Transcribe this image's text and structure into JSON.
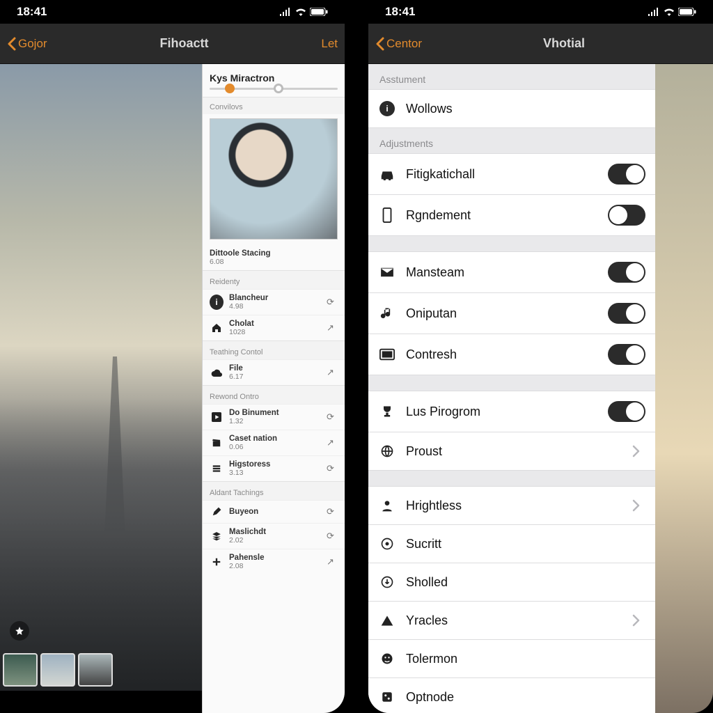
{
  "status": {
    "time": "18:41"
  },
  "left": {
    "nav": {
      "back": "Gojor",
      "title": "Fihoactt",
      "action": "Let"
    },
    "panel": {
      "header": "Kys Miractron",
      "groups": [
        {
          "caption": "Convilovs",
          "portrait": true,
          "meta": {
            "label": "Dittoole Stacing",
            "sub": "6.08"
          }
        },
        {
          "caption": "Reidenty",
          "items": [
            {
              "icon": "badge-icon",
              "label": "Blancheur",
              "sub": "4.98",
              "acc": "loop"
            },
            {
              "icon": "home-icon",
              "label": "Cholat",
              "sub": "1028",
              "acc": "out"
            }
          ]
        },
        {
          "caption": "Teathing Contol",
          "items": [
            {
              "icon": "cloud-icon",
              "label": "File",
              "sub": "6.17",
              "acc": "out"
            }
          ]
        },
        {
          "caption": "Rewond Ontro",
          "items": [
            {
              "icon": "play-icon",
              "label": "Do Binument",
              "sub": "1.32",
              "acc": "loop"
            },
            {
              "icon": "clapper-icon",
              "label": "Caset nation",
              "sub": "0.06",
              "acc": "out"
            },
            {
              "icon": "list-icon",
              "label": "Higstoress",
              "sub": "3.13",
              "acc": "loop"
            }
          ]
        },
        {
          "caption": "Aldant Tachings",
          "items": [
            {
              "icon": "pencil-icon",
              "label": "Buyeon",
              "sub": "",
              "acc": "loop"
            },
            {
              "icon": "stack-icon",
              "label": "Maslichdt",
              "sub": "2.02",
              "acc": "loop"
            },
            {
              "icon": "plus-icon",
              "label": "Pahensle",
              "sub": "2.08",
              "acc": "out"
            }
          ]
        }
      ]
    }
  },
  "right": {
    "nav": {
      "back": "Centor",
      "title": "Vhotial",
      "action": ""
    },
    "sections": [
      {
        "caption": "Asstument",
        "cells": [
          {
            "icon": "info-icon",
            "label": "Wollows",
            "accessory": "none"
          }
        ]
      },
      {
        "caption": "Adjustments",
        "cells": [
          {
            "icon": "car-icon",
            "label": "Fitigkatichall",
            "accessory": "toggle-on"
          },
          {
            "icon": "phone-icon",
            "label": "Rgndement",
            "accessory": "toggle-off"
          }
        ]
      },
      {
        "caption": "",
        "cells": [
          {
            "icon": "mail-icon",
            "label": "Mansteam",
            "accessory": "toggle-on"
          },
          {
            "icon": "note-icon",
            "label": "Oniputan",
            "accessory": "toggle-on"
          },
          {
            "icon": "window-icon",
            "label": "Contresh",
            "accessory": "toggle-on"
          }
        ]
      },
      {
        "caption": "",
        "cells": [
          {
            "icon": "trophy-icon",
            "label": "Lus Pirogrom",
            "accessory": "toggle-on"
          },
          {
            "icon": "globe-icon",
            "label": "Proust",
            "accessory": "chevron"
          }
        ]
      },
      {
        "caption": "",
        "cells": [
          {
            "icon": "person-icon",
            "label": "Hrightless",
            "accessory": "chevron"
          },
          {
            "icon": "gear-icon",
            "label": "Sucritt",
            "accessory": "none"
          },
          {
            "icon": "download-icon",
            "label": "Sholled",
            "accessory": "none"
          },
          {
            "icon": "triangle-icon",
            "label": "Yracles",
            "accessory": "chevron"
          },
          {
            "icon": "face-icon",
            "label": "Tolermon",
            "accessory": "none"
          },
          {
            "icon": "dice-icon",
            "label": "Optnode",
            "accessory": "none"
          }
        ]
      }
    ]
  }
}
